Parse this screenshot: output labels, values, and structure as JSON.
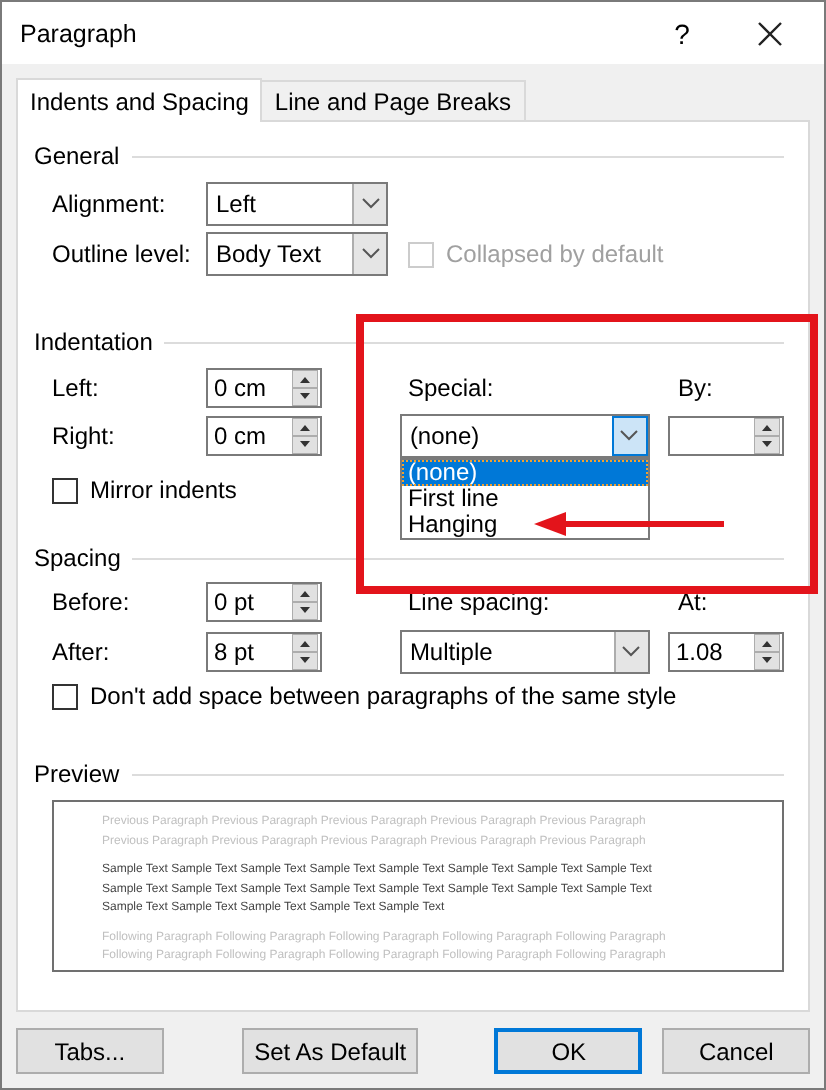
{
  "window": {
    "title": "Paragraph",
    "help": "?"
  },
  "tabs": [
    {
      "label": "Indents and Spacing",
      "selected": true
    },
    {
      "label": "Line and Page Breaks",
      "selected": false
    }
  ],
  "general": {
    "heading": "General",
    "alignment": {
      "label": "Alignment:",
      "value": "Left"
    },
    "outline_level": {
      "label": "Outline level:",
      "value": "Body Text"
    },
    "collapsed": {
      "label": "Collapsed by default",
      "checked": false,
      "disabled": true
    }
  },
  "indentation": {
    "heading": "Indentation",
    "left": {
      "label": "Left:",
      "value": "0 cm"
    },
    "right": {
      "label": "Right:",
      "value": "0 cm"
    },
    "mirror": {
      "label": "Mirror indents",
      "checked": false
    },
    "special": {
      "label": "Special:",
      "value": "(none)",
      "open": true,
      "options": [
        {
          "label": "(none)",
          "selected": true
        },
        {
          "label": "First line",
          "selected": false
        },
        {
          "label": "Hanging",
          "selected": false
        }
      ]
    },
    "by": {
      "label": "By:"
    }
  },
  "spacing": {
    "heading": "Spacing",
    "before": {
      "label": "Before:",
      "value": "0 pt"
    },
    "after": {
      "label": "After:",
      "value": "8 pt"
    },
    "line_spacing": {
      "label": "Line spacing:",
      "value": "Multiple"
    },
    "at": {
      "label": "At:",
      "value": "1.08"
    },
    "dont_add": {
      "label": "Don't add space between paragraphs of the same style",
      "checked": false
    }
  },
  "preview": {
    "heading": "Preview",
    "previous": [
      "Previous Paragraph Previous Paragraph Previous Paragraph Previous Paragraph Previous Paragraph",
      "Previous Paragraph Previous Paragraph Previous Paragraph Previous Paragraph Previous Paragraph"
    ],
    "sample": [
      "Sample Text Sample Text Sample Text Sample Text Sample Text Sample Text Sample Text Sample Text",
      "Sample Text Sample Text Sample Text Sample Text Sample Text Sample Text Sample Text Sample Text",
      "Sample Text Sample Text Sample Text Sample Text Sample Text"
    ],
    "following": [
      "Following Paragraph Following Paragraph Following Paragraph Following Paragraph Following Paragraph",
      "Following Paragraph Following Paragraph Following Paragraph Following Paragraph Following Paragraph"
    ]
  },
  "buttons": [
    {
      "label": "Tabs...",
      "default": false
    },
    {
      "label": "Set As Default",
      "default": false
    },
    {
      "label": "OK",
      "default": true
    },
    {
      "label": "Cancel",
      "default": false
    }
  ]
}
